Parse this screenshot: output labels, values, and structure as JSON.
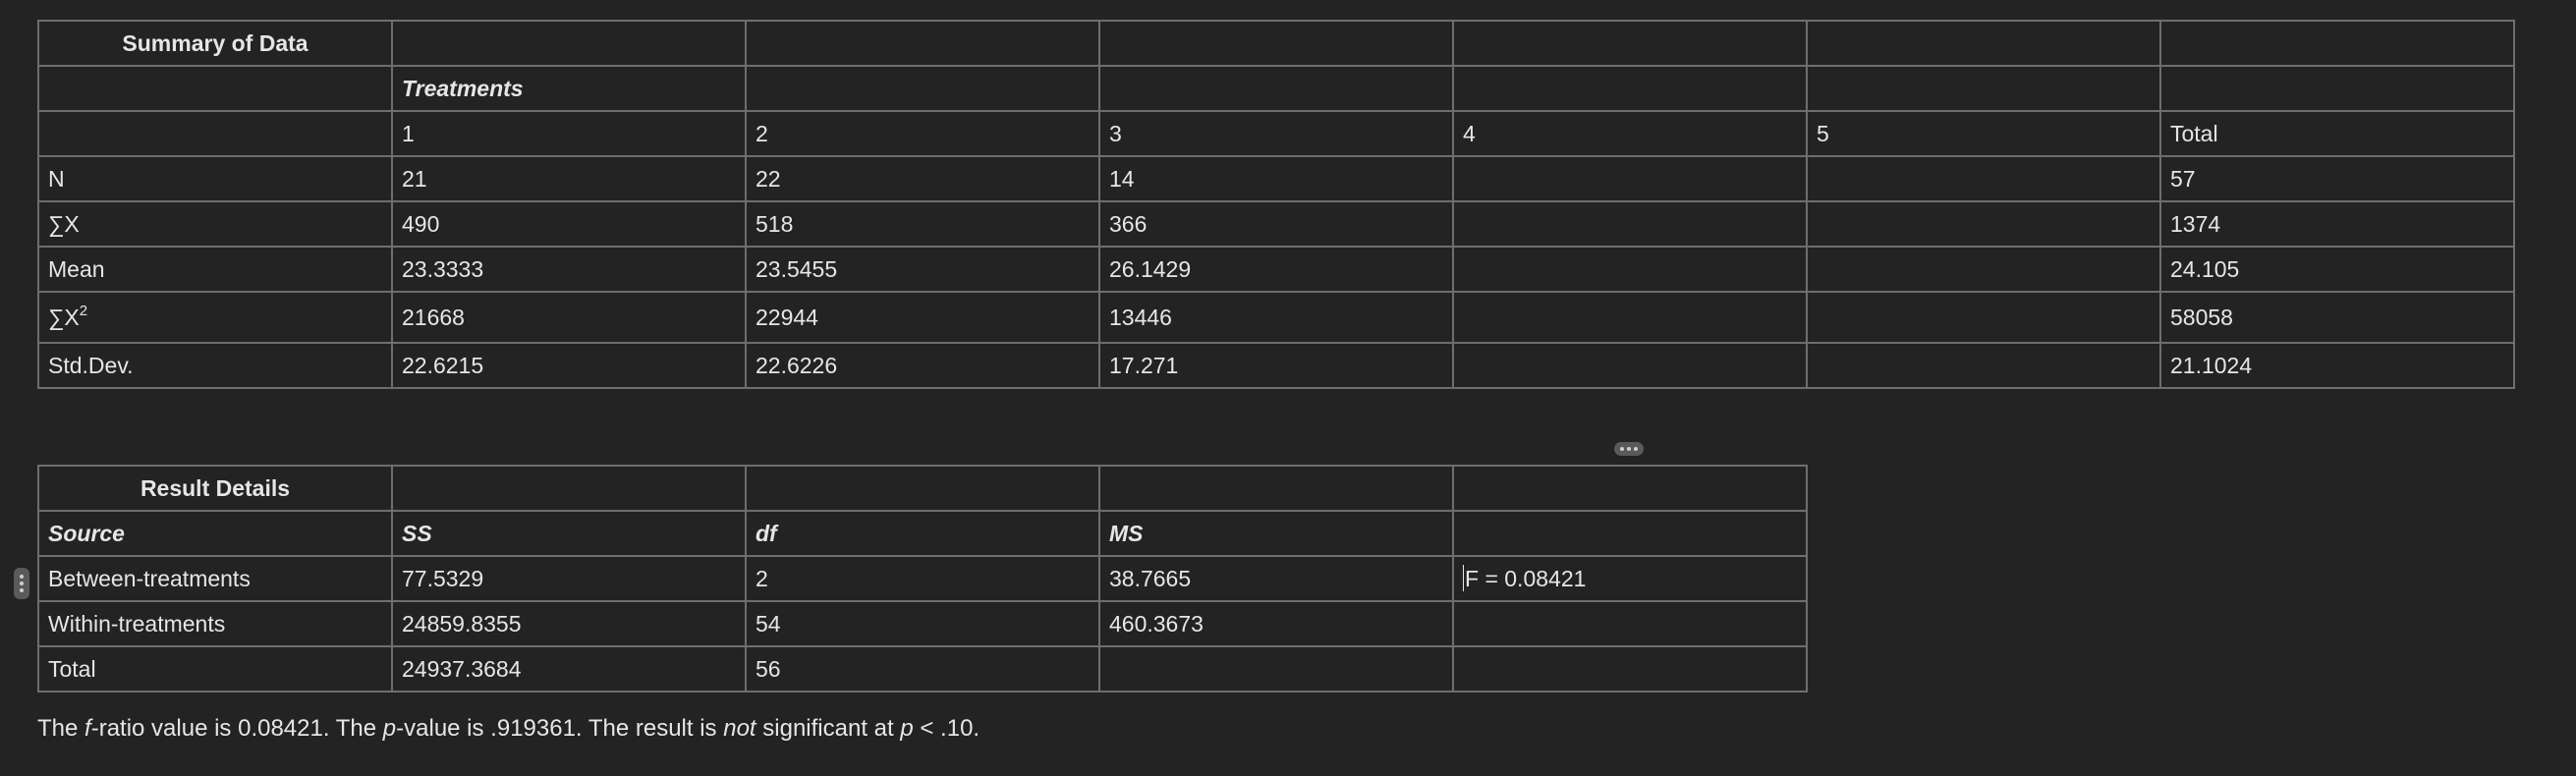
{
  "summary": {
    "title": "Summary of Data",
    "treatments_label": "Treatments",
    "columns": [
      "1",
      "2",
      "3",
      "4",
      "5",
      "Total"
    ],
    "rows": [
      {
        "label": "N",
        "values": [
          "21",
          "22",
          "14",
          "",
          "",
          "57"
        ]
      },
      {
        "label": "∑X",
        "values": [
          "490",
          "518",
          "366",
          "",
          "",
          "1374"
        ]
      },
      {
        "label": "Mean",
        "values": [
          "23.3333",
          "23.5455",
          "26.1429",
          "",
          "",
          "24.105"
        ]
      },
      {
        "label": "∑X",
        "label_sup": "2",
        "values": [
          "21668",
          "22944",
          "13446",
          "",
          "",
          "58058"
        ]
      },
      {
        "label": "Std.Dev.",
        "values": [
          "22.6215",
          "22.6226",
          "17.271",
          "",
          "",
          "21.1024"
        ]
      }
    ]
  },
  "results": {
    "title": "Result Details",
    "headers": [
      "Source",
      "SS",
      "df",
      "MS"
    ],
    "rows": [
      {
        "source": "Between-treatments",
        "ss": "77.5329",
        "df": "2",
        "ms": "38.7665",
        "f": "F = 0.08421"
      },
      {
        "source": "Within-treatments",
        "ss": "24859.8355",
        "df": "54",
        "ms": "460.3673",
        "f": ""
      },
      {
        "source": "Total",
        "ss": "24937.3684",
        "df": "56",
        "ms": "",
        "f": ""
      }
    ]
  },
  "conclusion": {
    "p1": "The ",
    "f_ital": "f",
    "p2": "-ratio value is 0.08421. The ",
    "p_ital": "p",
    "p3": "-value is .919361. The result is ",
    "not_ital": "not",
    "p4": " significant at ",
    "p_ital2": "p",
    "p5": " < .10."
  }
}
